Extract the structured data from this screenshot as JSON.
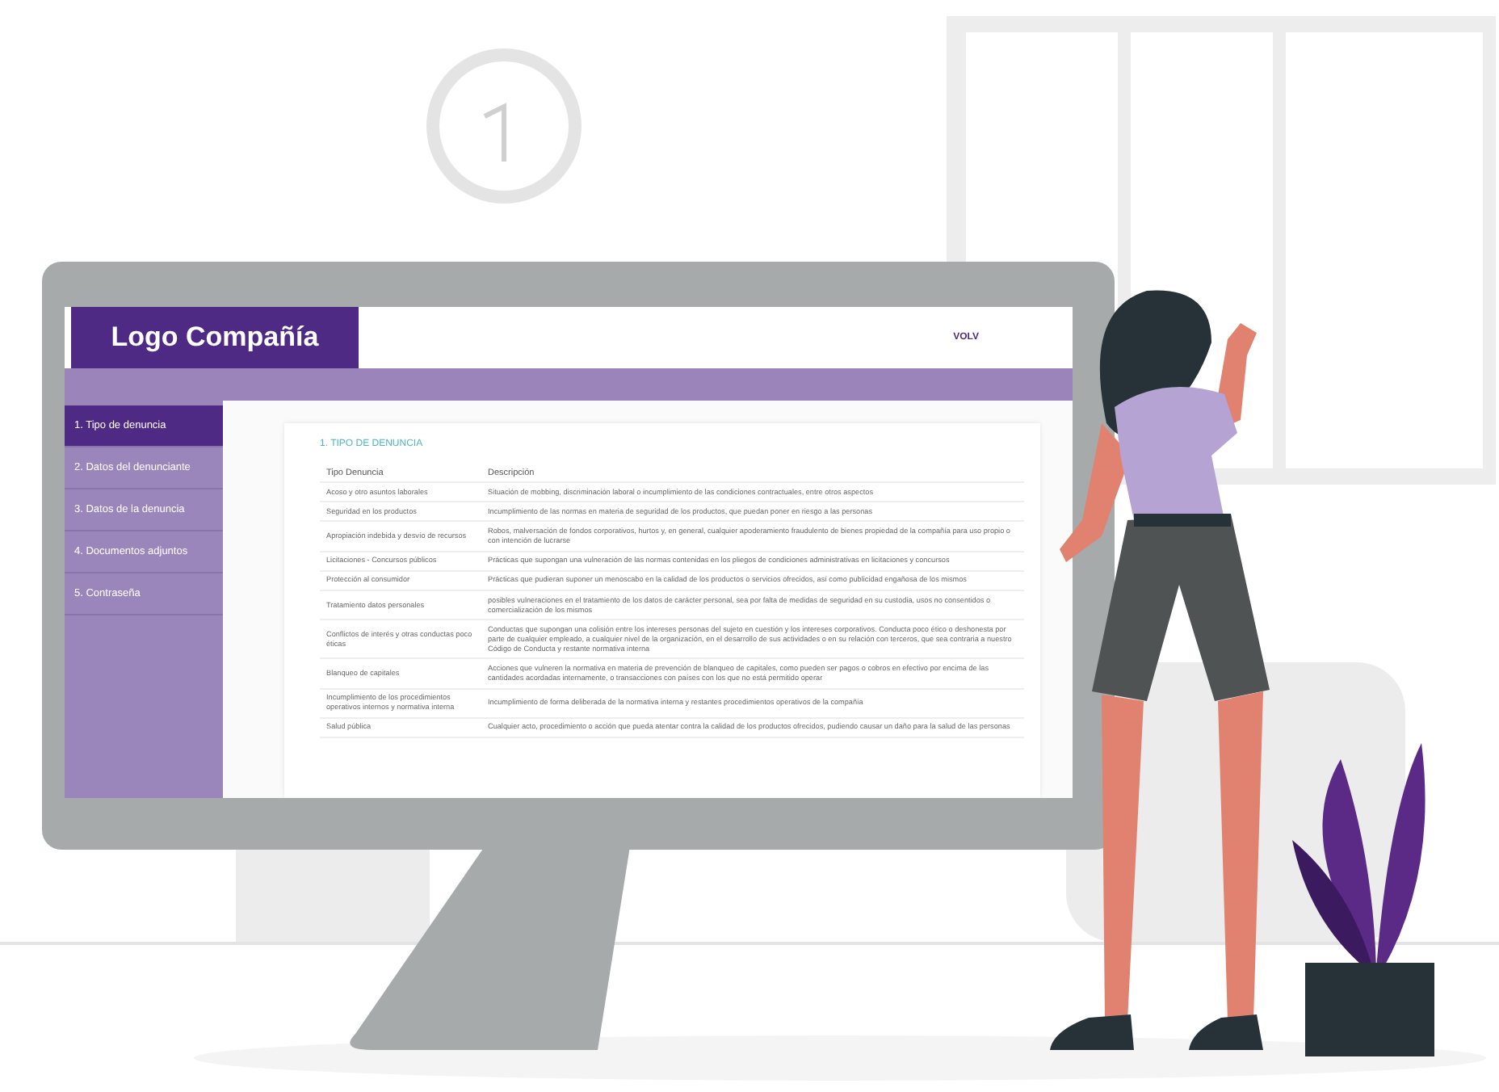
{
  "header": {
    "logo": "Logo Compañía",
    "link": "VOLV"
  },
  "sidebar": {
    "items": [
      {
        "label": "1. Tipo de denuncia",
        "selected": true
      },
      {
        "label": "2. Datos del denunciante",
        "selected": false
      },
      {
        "label": "3. Datos de la denuncia",
        "selected": false
      },
      {
        "label": "4. Documentos adjuntos",
        "selected": false
      },
      {
        "label": "5. Contraseña",
        "selected": false
      }
    ]
  },
  "section_title": "1. TIPO DE DENUNCIA",
  "table": {
    "columns": [
      "Tipo Denuncia",
      "Descripción"
    ],
    "rows": [
      [
        "Acoso y otro asuntos laborales",
        "Situación de mobbing, discriminación laboral o incumplimiento de las condiciones contractuales, entre otros aspectos"
      ],
      [
        "Seguridad en los productos",
        "Incumplimiento de las normas en materia de seguridad de los productos, que puedan poner en riesgo a las personas"
      ],
      [
        "Apropiación indebida y desvío de recursos",
        "Robos, malversación de fondos corporativos, hurtos y, en general, cualquier apoderamiento fraudulento de bienes propiedad de la compañía para uso propio o con intención de lucrarse"
      ],
      [
        "Licitaciones - Concursos públicos",
        "Prácticas que supongan una vulneración de las normas contenidas en los pliegos de condiciones administrativas en licitaciones y concursos"
      ],
      [
        "Protección al consumidor",
        "Prácticas que pudieran suponer un menoscabo en la calidad de los productos o servicios ofrecidos, así como publicidad engañosa de los mismos"
      ],
      [
        "Tratamiento datos personales",
        "posibles vulneraciones en el tratamiento de los datos de carácter personal, sea por falta de medidas de seguridad en su custodia, usos no consentidos o comercialización de los mismos"
      ],
      [
        "Conflictos de interés y otras conductas poco éticas",
        "Conductas que supongan una colisión entre los intereses personas del sujeto en cuestión y los intereses corporativos. Conducta poco ético o deshonesta por parte de cualquier empleado, a cualquier nivel de la organización, en el desarrollo de sus actividades o en su relación con terceros, que sea contraria a nuestro Código de Conducta y restante normativa interna"
      ],
      [
        "Blanqueo de capitales",
        "Acciones que vulneren la normativa en materia de prevención de blanqueo de capitales, como pueden ser pagos o cobros en efectivo por encima de las cantidades acordadas internamente, o transacciones con países con los que no está permitido operar"
      ],
      [
        "Incumplimiento de los procedimientos operativos internos y normativa interna",
        "Incumplimiento de forma deliberada de la normativa interna y restantes procedimientos operativos de la compañía"
      ],
      [
        "Salud pública",
        "Cualquier acto, procedimiento o acción que pueda atentar contra la calidad de los productos ofrecidos, pudiendo causar un daño para la salud de las personas"
      ]
    ]
  }
}
